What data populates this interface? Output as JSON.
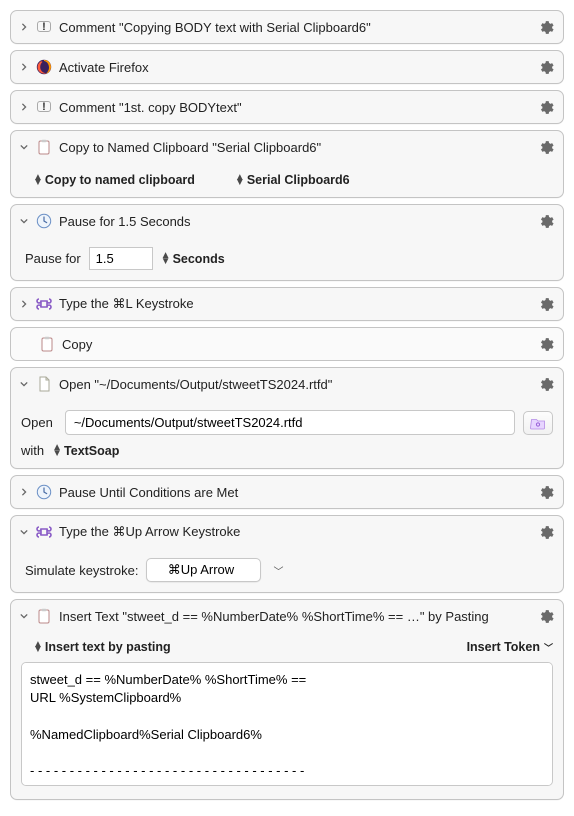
{
  "actions": {
    "comment1": {
      "title": "Comment \"Copying BODY text with Serial Clipboard6\""
    },
    "activate": {
      "title": "Activate Firefox"
    },
    "comment2": {
      "title": "Comment \"1st. copy BODYtext\""
    },
    "copyClipboard": {
      "title": "Copy to Named Clipboard \"Serial Clipboard6\"",
      "option1": "Copy to named clipboard",
      "option2": "Serial Clipboard6"
    },
    "pause": {
      "title": "Pause for 1.5 Seconds",
      "label": "Pause for",
      "value": "1.5",
      "unit": "Seconds"
    },
    "typeCmdL": {
      "title": "Type the ⌘L Keystroke"
    },
    "copy": {
      "title": "Copy"
    },
    "open": {
      "title": "Open \"~/Documents/Output/stweetTS2024.rtfd\"",
      "btnLabelOpen": "Open",
      "pathValue": "~/Documents/Output/stweetTS2024.rtfd",
      "withLabel": "with",
      "withApp": "TextSoap"
    },
    "pauseUntil": {
      "title": "Pause Until Conditions are Met"
    },
    "typeUp": {
      "title": "Type the ⌘Up Arrow Keystroke",
      "label": "Simulate keystroke:",
      "keystroke": "⌘Up Arrow"
    },
    "insertText": {
      "title": "Insert Text \"stweet_d == %NumberDate% %ShortTime% == …\" by Pasting",
      "option1": "Insert text by pasting",
      "tokenLabel": "Insert Token",
      "textContent": "stweet_d == %NumberDate% %ShortTime% ==\nURL %SystemClipboard%\n\n%NamedClipboard%Serial Clipboard6%\n\n- - - - - - - - - - - - - - - - - - - - - - - - - - - - - - - - - - -"
    }
  }
}
